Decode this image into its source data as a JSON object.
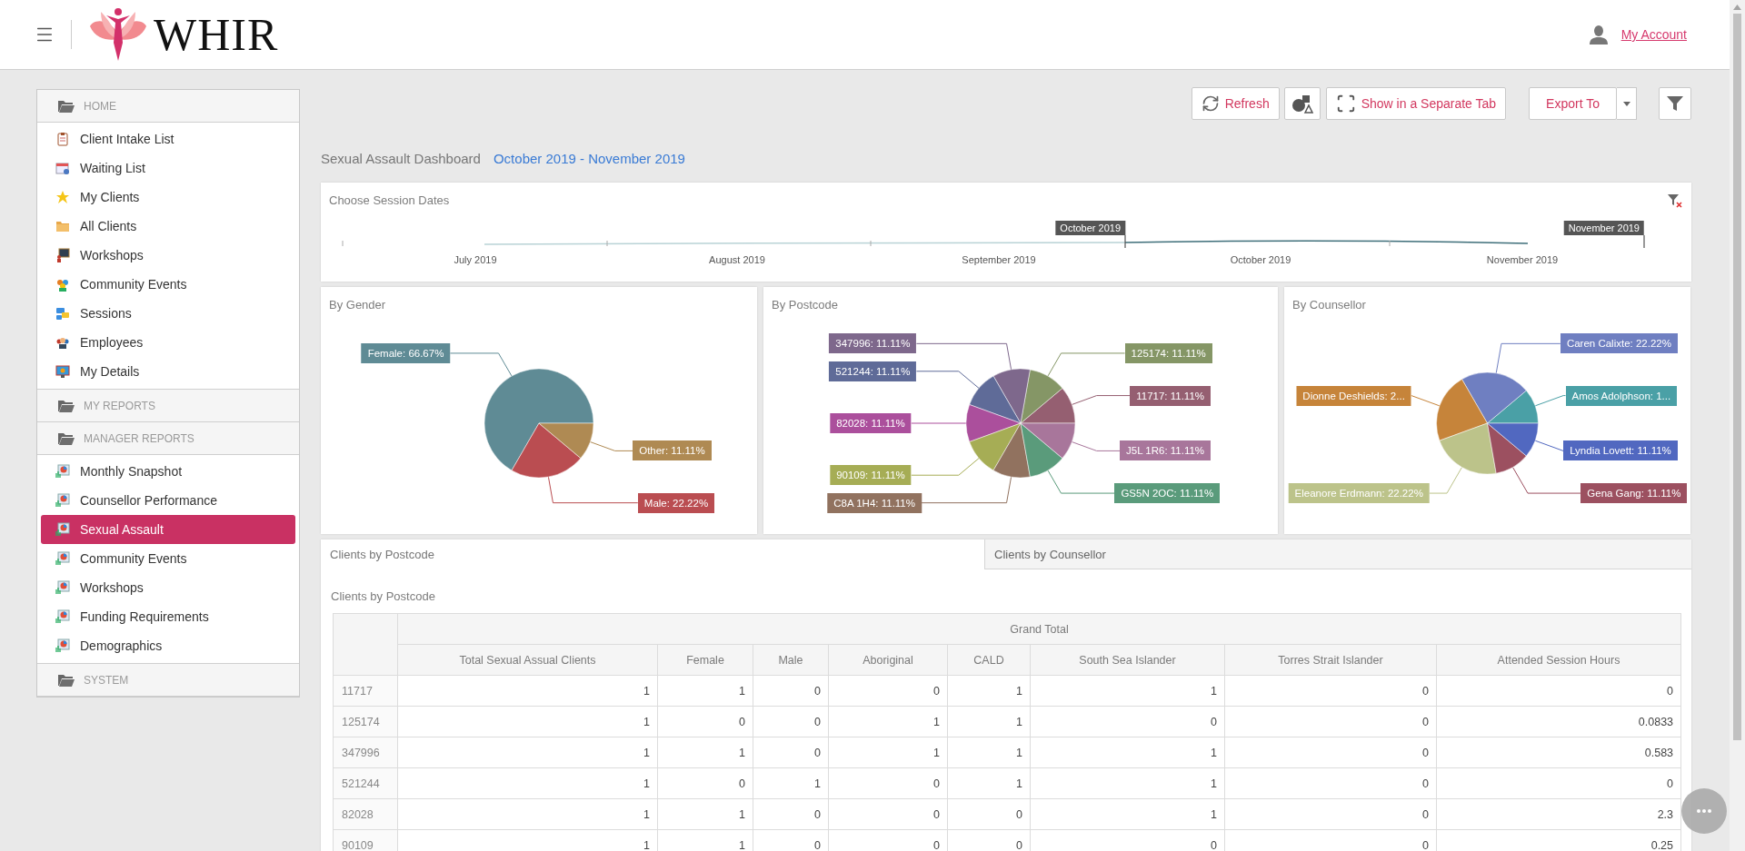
{
  "header": {
    "logo_text": "WHIR",
    "account_link": "My Account"
  },
  "sidebar": {
    "sections": [
      {
        "title": "HOME",
        "items": [
          {
            "label": "Client Intake List",
            "selected": false
          },
          {
            "label": "Waiting List",
            "selected": false
          },
          {
            "label": "My Clients",
            "selected": false
          },
          {
            "label": "All Clients",
            "selected": false
          },
          {
            "label": "Workshops",
            "selected": false
          },
          {
            "label": "Community Events",
            "selected": false
          },
          {
            "label": "Sessions",
            "selected": false
          },
          {
            "label": "Employees",
            "selected": false
          },
          {
            "label": "My Details",
            "selected": false
          }
        ]
      },
      {
        "title": "MY REPORTS"
      },
      {
        "title": "MANAGER REPORTS",
        "items": [
          {
            "label": "Monthly Snapshot",
            "selected": false
          },
          {
            "label": "Counsellor Performance",
            "selected": false
          },
          {
            "label": "Sexual Assault",
            "selected": true
          },
          {
            "label": "Community Events",
            "selected": false
          },
          {
            "label": "Workshops",
            "selected": false
          },
          {
            "label": "Funding Requirements",
            "selected": false
          },
          {
            "label": "Demographics",
            "selected": false
          }
        ]
      },
      {
        "title": "SYSTEM"
      }
    ]
  },
  "toolbar": {
    "refresh": "Refresh",
    "separate_tab": "Show in a Separate Tab",
    "export": "Export To"
  },
  "dashboard": {
    "title": "Sexual Assault Dashboard",
    "date_range": "October 2019 - November 2019"
  },
  "session_dates": {
    "title": "Choose Session Dates",
    "axis_labels": [
      "July 2019",
      "August 2019",
      "September 2019",
      "October 2019",
      "November 2019"
    ],
    "range_start": "October 2019",
    "range_end": "November 2019"
  },
  "pie_cards": [
    {
      "title": "By Gender",
      "chart_data": {
        "type": "pie",
        "categories": [
          "Female: 66.67%",
          "Male: 22.22%",
          "Other: 11.11%"
        ],
        "values": [
          66.67,
          22.22,
          11.11
        ],
        "colors": [
          "#5f8b95",
          "#ba4d51",
          "#af8a53"
        ]
      }
    },
    {
      "title": "By Postcode",
      "chart_data": {
        "type": "pie",
        "categories": [
          "11717: 11.11%",
          "125174: 11.11%",
          "347996: 11.11%",
          "521244: 11.11%",
          "82028: 11.11%",
          "90109: 11.11%",
          "C8A 1H4: 11.11%",
          "GS5N 2OC: 11.11%",
          "J5L 1R6: 11.11%"
        ],
        "values": [
          11.11,
          11.11,
          11.11,
          11.11,
          11.11,
          11.11,
          11.11,
          11.11,
          11.11
        ],
        "colors": [
          "#955f71",
          "#859666",
          "#7e688c",
          "#5f6b98",
          "#ab4f9c",
          "#a6ad55",
          "#91725f",
          "#5a9b7b",
          "#a8769b"
        ]
      }
    },
    {
      "title": "By Counsellor",
      "chart_data": {
        "type": "pie",
        "categories": [
          "Amos Adolphson: 1...",
          "Caren Calixte: 22.22%",
          "Dionne Deshields: 2...",
          "Eleanore Erdmann: 22.22%",
          "Gena Gang: 11.11%",
          "Lyndia Lovett: 11.11%"
        ],
        "values": [
          11.11,
          22.22,
          22.22,
          22.22,
          11.11,
          11.11
        ],
        "colors": [
          "#4aa0a6",
          "#6f7fc1",
          "#c6843a",
          "#bcc38a",
          "#9c5060",
          "#5168c0"
        ]
      }
    }
  ],
  "pivot": {
    "tabs": [
      {
        "label": "Clients by Postcode",
        "selected": true
      },
      {
        "label": "Clients by Counsellor",
        "selected": false
      }
    ],
    "title": "Clients by Postcode",
    "grand_total": "Grand Total",
    "columns": [
      "Total Sexual Assual Clients",
      "Female",
      "Male",
      "Aboriginal",
      "CALD",
      "South Sea Islander",
      "Torres Strait Islander",
      "Attended Session Hours"
    ],
    "rows": [
      {
        "key": "11717",
        "cells": [
          "1",
          "1",
          "0",
          "0",
          "1",
          "1",
          "0",
          "0"
        ]
      },
      {
        "key": "125174",
        "cells": [
          "1",
          "0",
          "0",
          "1",
          "1",
          "0",
          "0",
          "0.0833"
        ]
      },
      {
        "key": "347996",
        "cells": [
          "1",
          "1",
          "0",
          "1",
          "1",
          "1",
          "0",
          "0.583"
        ]
      },
      {
        "key": "521244",
        "cells": [
          "1",
          "0",
          "1",
          "0",
          "1",
          "1",
          "0",
          "0"
        ]
      },
      {
        "key": "82028",
        "cells": [
          "1",
          "1",
          "0",
          "0",
          "0",
          "1",
          "0",
          "2.3"
        ]
      },
      {
        "key": "90109",
        "cells": [
          "1",
          "1",
          "0",
          "0",
          "0",
          "0",
          "0",
          "0.25"
        ]
      }
    ]
  }
}
